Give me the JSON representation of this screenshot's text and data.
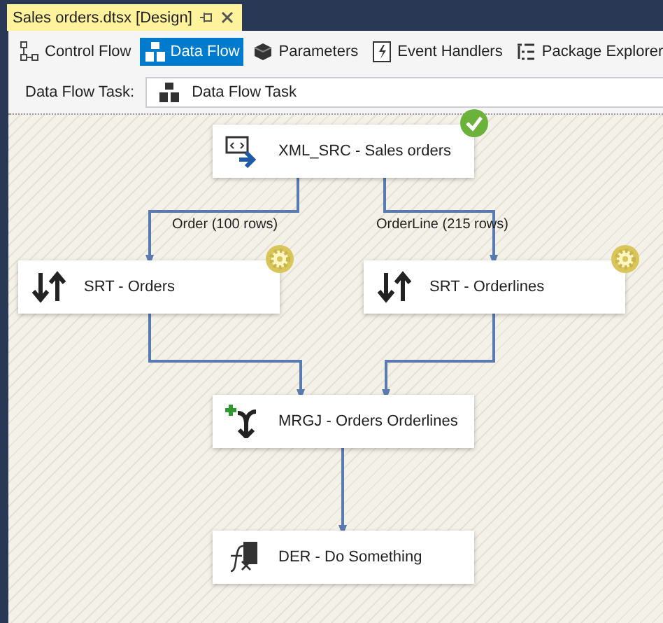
{
  "document_tab": {
    "title": "Sales orders.dtsx [Design]"
  },
  "designer_tabs": [
    {
      "label": "Control Flow",
      "selected": false
    },
    {
      "label": "Data Flow",
      "selected": true
    },
    {
      "label": "Parameters",
      "selected": false
    },
    {
      "label": "Event Handlers",
      "selected": false
    },
    {
      "label": "Package Explorer",
      "selected": false
    }
  ],
  "task_selector": {
    "label": "Data Flow Task:",
    "value": "Data Flow Task"
  },
  "components": [
    {
      "kind": "source",
      "name": "XML_SRC - Sales orders",
      "completed": true,
      "running": false
    },
    {
      "kind": "sort",
      "name": "SRT - Orders",
      "completed": false,
      "running": true
    },
    {
      "kind": "sort",
      "name": "SRT - Orderlines",
      "completed": false,
      "running": true
    },
    {
      "kind": "merge_join",
      "name": "MRGJ - Orders Orderlines",
      "completed": false,
      "running": false
    },
    {
      "kind": "derived_column",
      "name": "DER - Do Something",
      "completed": false,
      "running": false
    }
  ],
  "paths": [
    {
      "label": "Order (100 rows)"
    },
    {
      "label": "OrderLine (215 rows)"
    }
  ]
}
